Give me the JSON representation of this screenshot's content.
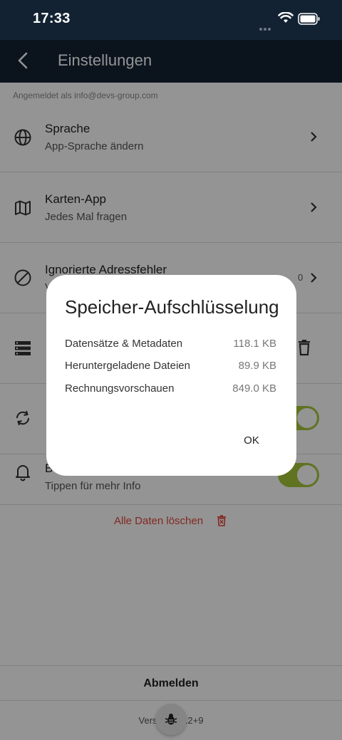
{
  "status_bar": {
    "time": "17:33"
  },
  "app_bar": {
    "title": "Einstellungen"
  },
  "account": {
    "prefix": "Angemeldet als",
    "email": "info@devs-group.com"
  },
  "settings": [
    {
      "title": "Sprache",
      "subtitle": "App-Sprache ändern",
      "icon": "globe-icon"
    },
    {
      "title": "Karten-App",
      "subtitle": "Jedes Mal fragen",
      "icon": "map-icon"
    },
    {
      "title": "Ignorierte Adressfehler",
      "subtitle": "V",
      "count": "0",
      "icon": "block-icon"
    },
    {
      "title": "",
      "subtitle": "",
      "icon": "storage-icon"
    },
    {
      "title": "",
      "subtitle": "",
      "icon": "sync-icon"
    },
    {
      "title": "B",
      "subtitle": "Tippen für mehr Info",
      "icon": "bell-icon"
    }
  ],
  "delete_all": {
    "label": "Alle Daten löschen"
  },
  "logout": {
    "label": "Abmelden"
  },
  "version": {
    "prefix": "Vers",
    "suffix": ".2+9"
  },
  "dialog": {
    "title": "Speicher-Aufschlüsselung",
    "rows": [
      {
        "label": "Datensätze & Metadaten",
        "value": "118.1 KB"
      },
      {
        "label": "Heruntergeladene Dateien",
        "value": "89.9 KB"
      },
      {
        "label": "Rechnungsvorschauen",
        "value": "849.0 KB"
      }
    ],
    "ok_label": "OK"
  },
  "colors": {
    "header_bg": "#132232",
    "toggle_on": "#a4c639",
    "danger": "#e0473a"
  }
}
